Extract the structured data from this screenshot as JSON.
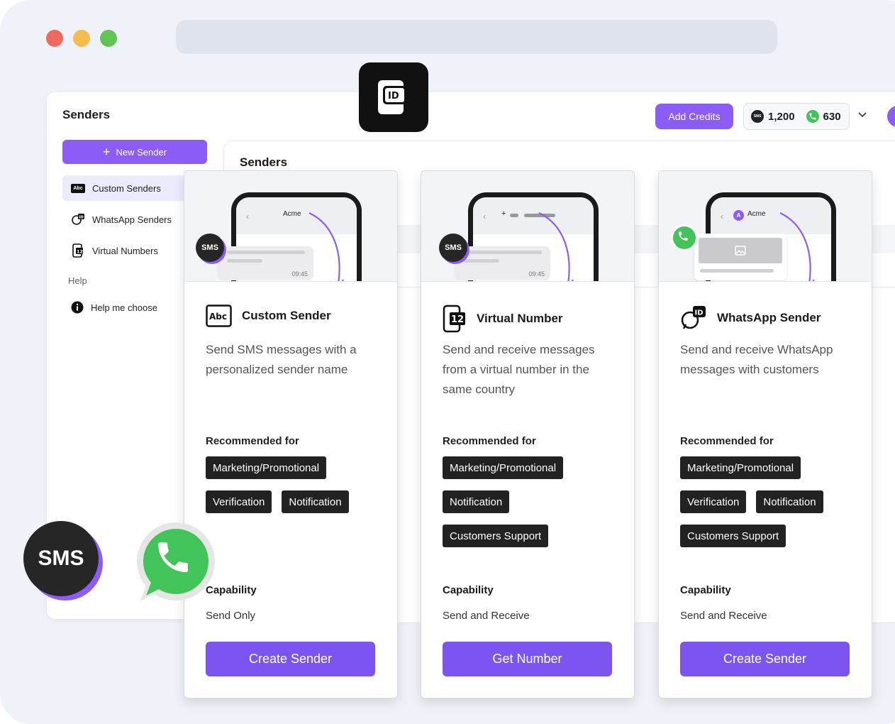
{
  "app": {
    "title": "Senders",
    "add_credits_label": "Add Credits",
    "sms_credits": "1,200",
    "whatsapp_credits": "630",
    "brand_color": "#8b5cf6"
  },
  "sidebar": {
    "new_sender_label": "New Sender",
    "items": [
      {
        "label": "Custom Senders",
        "icon": "abc-icon",
        "active": true
      },
      {
        "label": "WhatsApp Senders",
        "icon": "whatsapp-id-icon"
      },
      {
        "label": "Virtual Numbers",
        "icon": "phone-12-icon"
      }
    ],
    "help_heading": "Help",
    "help_item": "Help me choose"
  },
  "panel": {
    "title": "Senders"
  },
  "cards": [
    {
      "hero_name": "Acme",
      "hero_time": "09:45",
      "title": "Custom Sender",
      "description": "Send SMS messages with a personalized sender name",
      "recommended_label": "Recommended for",
      "tags": [
        "Marketing/Promotional",
        "Verification",
        "Notification"
      ],
      "capability_label": "Capability",
      "capability": "Send Only",
      "button": "Create Sender"
    },
    {
      "hero_time": "09:45",
      "title": "Virtual Number",
      "description": "Send and receive messages from a virtual number in the same country",
      "recommended_label": "Recommended for",
      "tags": [
        "Marketing/Promotional",
        "Notification",
        "Customers Support"
      ],
      "capability_label": "Capability",
      "capability": "Send and Receive",
      "button": "Get Number"
    },
    {
      "hero_name": "Acme",
      "title": "WhatsApp Sender",
      "description": "Send and receive WhatsApp messages with customers",
      "recommended_label": "Recommended for",
      "tags": [
        "Marketing/Promotional",
        "Verification",
        "Notification",
        "Customers Support"
      ],
      "capability_label": "Capability",
      "capability": "Send and Receive",
      "button": "Create Sender"
    }
  ],
  "badges": {
    "sms": "SMS"
  }
}
